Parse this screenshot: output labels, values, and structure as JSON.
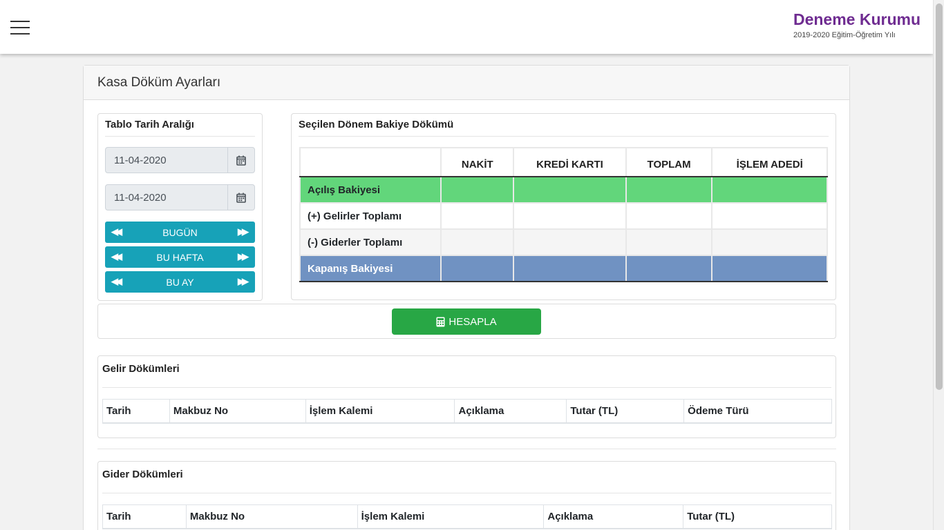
{
  "header": {
    "brand": "Deneme Kurumu",
    "subtitle": "2019-2020 Eğitim-Öğretim Yılı"
  },
  "page": {
    "title": "Kasa Döküm Ayarları"
  },
  "date_range": {
    "title": "Tablo Tarih Aralığı",
    "start": "11-04-2020",
    "end": "11-04-2020",
    "buttons": [
      "BUGÜN",
      "BU HAFTA",
      "BU AY"
    ]
  },
  "balance": {
    "title": "Seçilen Dönem Bakiye Dökümü",
    "columns": [
      "NAKİT",
      "KREDİ KARTI",
      "TOPLAM",
      "İŞLEM ADEDİ"
    ],
    "rows": [
      {
        "label": "Açılış Bakiyesi",
        "values": [
          "",
          "",
          "",
          ""
        ]
      },
      {
        "label": "(+) Gelirler Toplamı",
        "values": [
          "",
          "",
          "",
          ""
        ]
      },
      {
        "label": "(-) Giderler Toplamı",
        "values": [
          "",
          "",
          "",
          ""
        ]
      },
      {
        "label": "Kapanış Bakiyesi",
        "values": [
          "",
          "",
          "",
          ""
        ]
      }
    ]
  },
  "actions": {
    "calculate": "HESAPLA"
  },
  "income": {
    "title": "Gelir Dökümleri",
    "columns": [
      "Tarih",
      "Makbuz No",
      "İşlem Kalemi",
      "Açıklama",
      "Tutar (TL)",
      "Ödeme Türü"
    ]
  },
  "expense": {
    "title": "Gider Dökümleri",
    "columns": [
      "Tarih",
      "Makbuz No",
      "İşlem Kalemi",
      "Açıklama",
      "Tutar (TL)"
    ]
  },
  "colors": {
    "brand": "#6f2c91",
    "info": "#17a2b8",
    "success": "#28a745",
    "opening_row": "#62d67b",
    "closing_row": "#7092c2"
  }
}
